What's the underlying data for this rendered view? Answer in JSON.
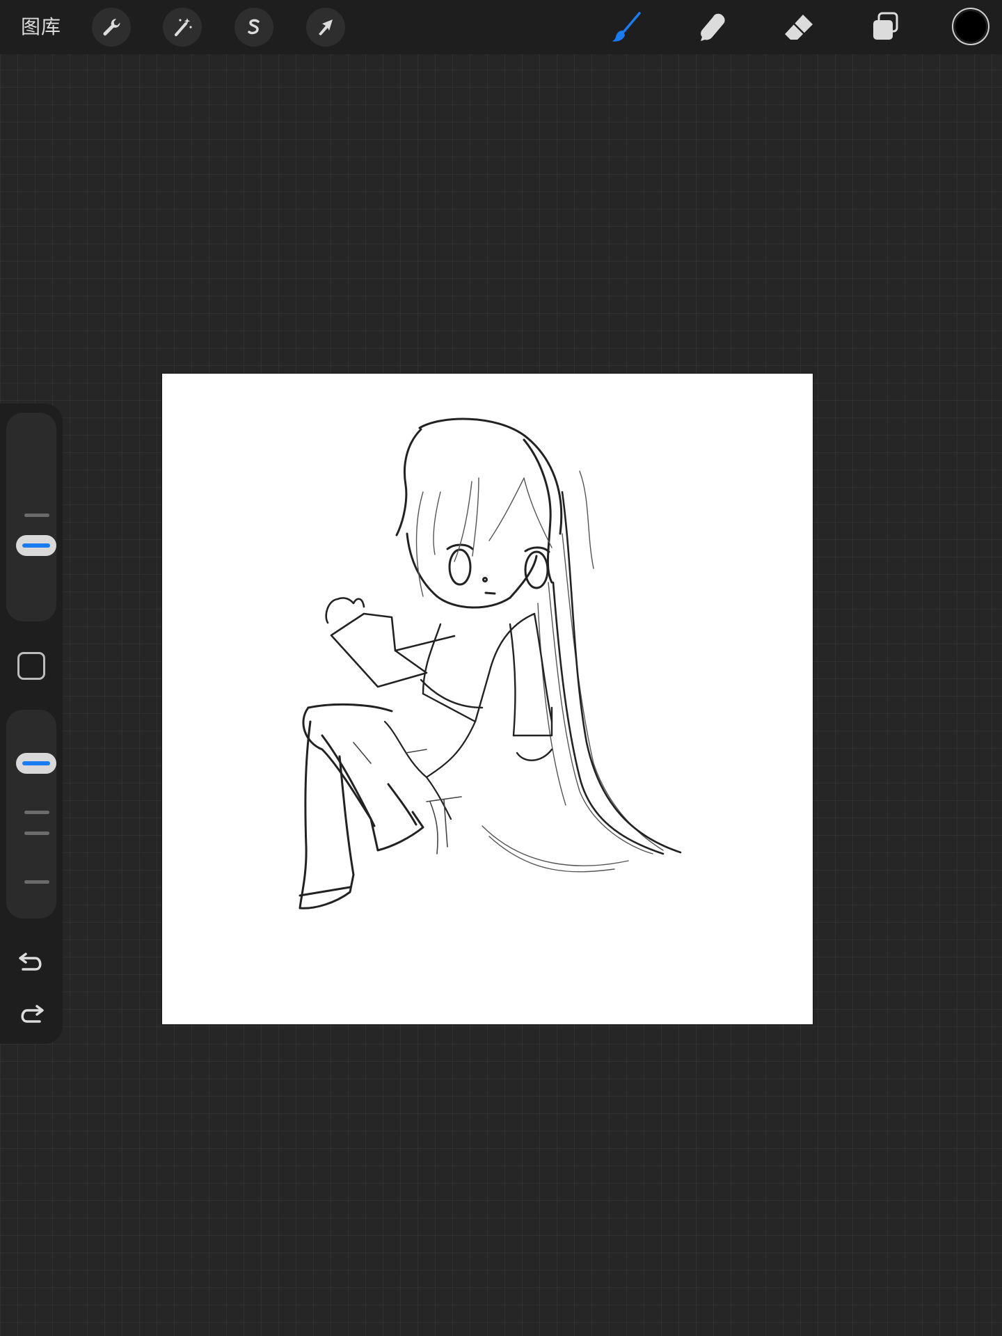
{
  "toolbar": {
    "gallery_label": "图库",
    "left_tools": [
      {
        "name": "actions",
        "icon": "wrench-icon"
      },
      {
        "name": "adjustments",
        "icon": "magic-wand-icon"
      },
      {
        "name": "selection",
        "icon": "selection-s-icon"
      },
      {
        "name": "transform",
        "icon": "arrow-cursor-icon"
      }
    ],
    "right_tools": [
      {
        "name": "brush",
        "icon": "brush-icon",
        "active": true
      },
      {
        "name": "smudge",
        "icon": "smudge-finger-icon",
        "active": false
      },
      {
        "name": "eraser",
        "icon": "eraser-icon",
        "active": false
      },
      {
        "name": "layers",
        "icon": "layers-icon",
        "active": false
      }
    ],
    "current_color": "#000000"
  },
  "sidebar": {
    "brush_size_slider": {
      "icon": "slider-thumb"
    },
    "modify_button": {
      "icon": "square-outline-icon"
    },
    "opacity_slider": {
      "icon": "slider-thumb"
    },
    "undo": {
      "icon": "undo-arrow-icon"
    },
    "redo": {
      "icon": "redo-arrow-icon"
    }
  },
  "canvas": {
    "background": "#ffffff",
    "content": "pencil-sketch"
  },
  "colors": {
    "accent": "#1a7cf2",
    "app_background": "#262626",
    "toolbar_background": "#1e1e1e",
    "icon_color": "#dcdcdc"
  }
}
